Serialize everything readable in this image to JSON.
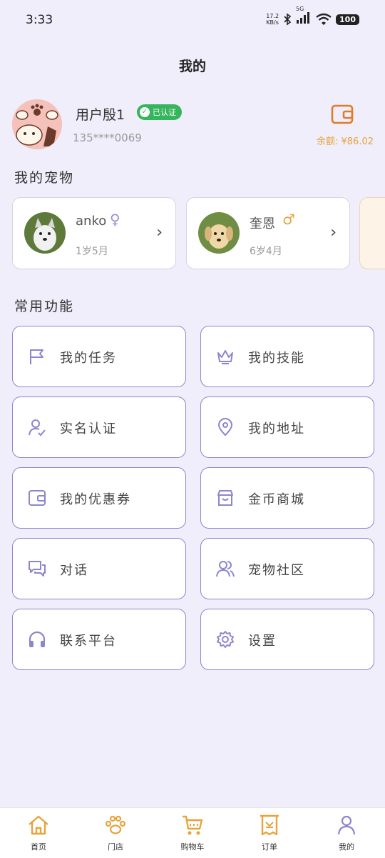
{
  "status": {
    "time": "3:33",
    "net_speed": "17.2",
    "net_unit": "KB/s",
    "network": "5G",
    "battery": "100"
  },
  "page": {
    "title": "我的"
  },
  "profile": {
    "username": "用户殷1",
    "verified_label": "已认证",
    "phone": "135****0069",
    "balance": "余额: ¥86.02"
  },
  "pets": {
    "title": "我的宠物",
    "items": [
      {
        "name": "anko",
        "gender": "♀",
        "age": "1岁5月"
      },
      {
        "name": "奎恩",
        "gender": "♂",
        "age": "6岁4月"
      }
    ]
  },
  "functions": {
    "title": "常用功能",
    "items": [
      {
        "label": "我的任务",
        "icon": "flag-icon"
      },
      {
        "label": "我的技能",
        "icon": "crown-icon"
      },
      {
        "label": "实名认证",
        "icon": "user-check-icon"
      },
      {
        "label": "我的地址",
        "icon": "location-pin-icon"
      },
      {
        "label": "我的优惠券",
        "icon": "coupon-wallet-icon"
      },
      {
        "label": "金币商城",
        "icon": "store-icon"
      },
      {
        "label": "对话",
        "icon": "chat-icon"
      },
      {
        "label": "宠物社区",
        "icon": "users-icon"
      },
      {
        "label": "联系平台",
        "icon": "headphones-icon"
      },
      {
        "label": "设置",
        "icon": "gear-icon"
      }
    ]
  },
  "tabs": [
    {
      "label": "首页",
      "icon": "home-icon"
    },
    {
      "label": "门店",
      "icon": "paw-icon"
    },
    {
      "label": "购物车",
      "icon": "cart-icon"
    },
    {
      "label": "订单",
      "icon": "order-icon"
    },
    {
      "label": "我的",
      "icon": "profile-icon"
    }
  ],
  "colors": {
    "accent": "#e8a33b",
    "purple": "#8c86cf",
    "verified": "#35b55c",
    "background": "#efeefa"
  }
}
